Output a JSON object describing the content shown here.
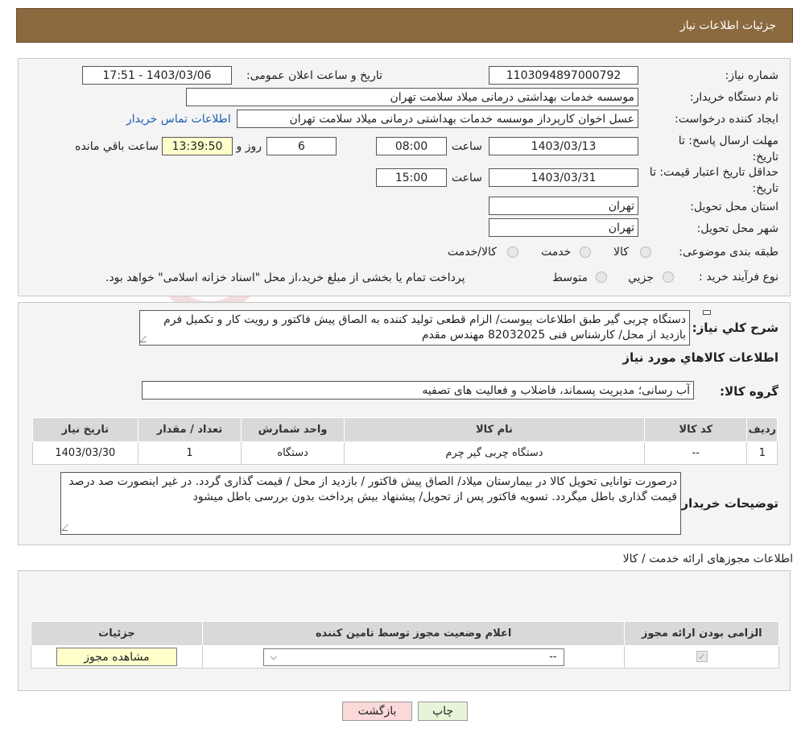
{
  "header": {
    "title": "جزئیات اطلاعات نیاز"
  },
  "fields": {
    "need_number_label": "شماره نیاز:",
    "need_number": "1103094897000792",
    "announce_label": "تاریخ و ساعت اعلان عمومی:",
    "announce_value": "1403/03/06 - 17:51",
    "buyer_org_label": "نام دستگاه خریدار:",
    "buyer_org": "موسسه خدمات بهداشتی درمانی میلاد سلامت تهران",
    "creator_label": "ایجاد کننده درخواست:",
    "creator": "عسل اخوان کارپرداز موسسه خدمات بهداشتی درمانی میلاد سلامت تهران",
    "contact_link": "اطلاعات تماس خریدار",
    "reply_deadline_label": "مهلت ارسال پاسخ: تا تاریخ:",
    "reply_date": "1403/03/13",
    "time_label": "ساعت",
    "reply_time": "08:00",
    "days_value": "6",
    "days_label": "روز و",
    "remaining_time": "13:39:50",
    "remaining_label": "ساعت باقي مانده",
    "validity_label": "حداقل تاریخ اعتبار قیمت: تا تاریخ:",
    "validity_date": "1403/03/31",
    "validity_time": "15:00",
    "province_label": "استان محل تحویل:",
    "province": "تهران",
    "city_label": "شهر محل تحویل:",
    "city": "تهران",
    "category_label": "طبقه بندی موضوعی:",
    "category_options": [
      "کالا",
      "خدمت",
      "کالا/خدمت"
    ],
    "process_label": "نوع فرآیند خرید :",
    "process_options": [
      "جزیي",
      "متوسط"
    ],
    "process_note": "پرداخت تمام یا بخشی از مبلغ خرید،از محل \"اسناد خزانه اسلامی\" خواهد بود."
  },
  "description": {
    "label": "شرح کلي نياز:",
    "text": "دستگاه چربی گیر طبق اطلاعات پیوست/ الزام قطعی تولید کننده به الصاق پیش فاکتور و رویت کار و تکمیل فرم بازدید از محل/ کارشناس فنی 82032025 مهندس مقدم"
  },
  "goods": {
    "section_title": "اطلاعات کالاهاي مورد نياز",
    "group_label": "گروه کالا:",
    "group_value": "آب رسانی؛ مدیریت پسماند، فاضلاب و فعالیت های تصفیه",
    "columns": [
      "ردیف",
      "کد کالا",
      "نام کالا",
      "واحد شمارش",
      "تعداد / مقدار",
      "تاریخ نیاز"
    ],
    "rows": [
      [
        "1",
        "--",
        "دستگاه چربی گیر چرم",
        "دستگاه",
        "1",
        "1403/03/30"
      ]
    ]
  },
  "buyer_notes": {
    "label": "توضیحات خریدار:",
    "text": "درصورت توانایی تحویل کالا در بیمارستان میلاد/ الصاق پیش فاکتور / بازدید از محل  / قیمت گذاری گردد. در غیر اینصورت صد درصد قیمت گذاری باطل میگردد. تسویه فاکتور پس از تحویل/ پیشنهاد بیش پرداخت بدون بررسی باطل میشود"
  },
  "permits": {
    "section_title": "اطلاعات مجوزهای ارائه خدمت / کالا",
    "columns": [
      "الزامی بودن ارائه مجوز",
      "اعلام وضعیت مجوز توسط تامین کننده",
      "جزئیات"
    ],
    "select_value": "--",
    "view_button": "مشاهده مجوز"
  },
  "buttons": {
    "print": "چاپ",
    "back": "بازگشت"
  },
  "watermark": {
    "text": "AriaTender.neT"
  },
  "colors": {
    "header": "#8b6a3f",
    "yellow": "#ffffcc",
    "back_btn": "#fbd9d9",
    "print_btn": "#e6f5d8"
  }
}
